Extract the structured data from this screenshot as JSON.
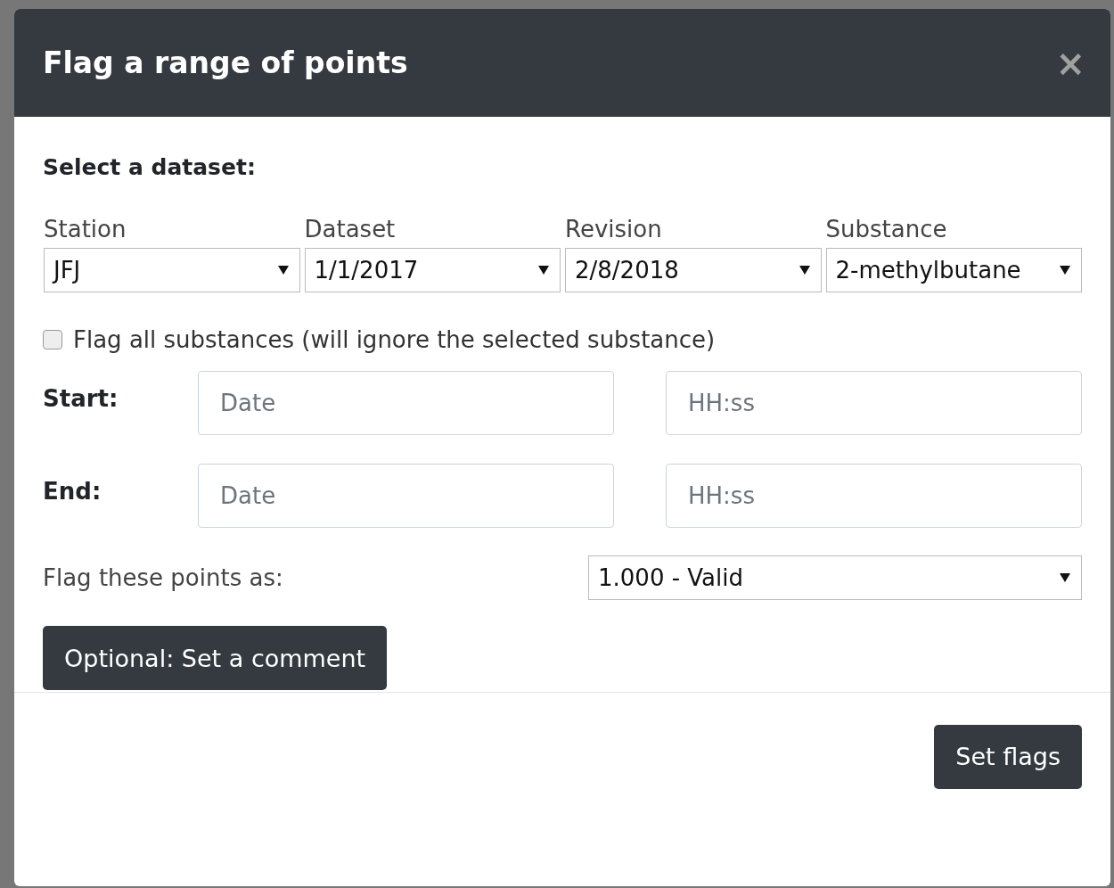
{
  "dialog": {
    "title": "Flag a range of points",
    "close": "×"
  },
  "section_title": "Select a dataset:",
  "selects": [
    {
      "label": "Station",
      "value": "JFJ"
    },
    {
      "label": "Dataset",
      "value": "1/1/2017"
    },
    {
      "label": "Revision",
      "value": "2/8/2018"
    },
    {
      "label": "Substance",
      "value": "2-methylbutane"
    }
  ],
  "flag_all": {
    "label": "Flag all substances (will ignore the selected substance)",
    "checked": false
  },
  "range": [
    {
      "label": "Start:",
      "date": {
        "placeholder": "Date"
      },
      "time": {
        "placeholder": "HH:ss"
      }
    },
    {
      "label": "End:",
      "date": {
        "placeholder": "Date"
      },
      "time": {
        "placeholder": "HH:ss"
      }
    }
  ],
  "flag_as": {
    "label": "Flag these points as:",
    "value": "1.000 - Valid"
  },
  "comment_button": "Optional: Set a comment",
  "submit_button": "Set flags"
}
